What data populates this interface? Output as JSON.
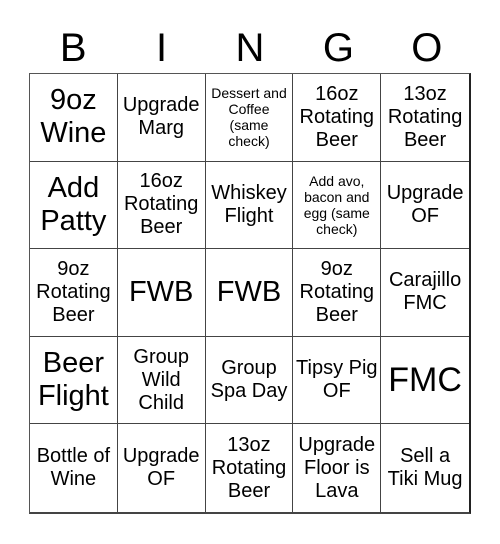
{
  "header": {
    "letters": [
      "B",
      "I",
      "N",
      "G",
      "O"
    ]
  },
  "cells": [
    {
      "text": "9oz Wine",
      "size": "l"
    },
    {
      "text": "Upgrade Marg",
      "size": "m"
    },
    {
      "text": "Dessert and Coffee (same check)",
      "size": "xs"
    },
    {
      "text": "16oz Rotating Beer",
      "size": "m"
    },
    {
      "text": "13oz Rotating Beer",
      "size": "m"
    },
    {
      "text": "Add Patty",
      "size": "l"
    },
    {
      "text": "16oz Rotating Beer",
      "size": "m"
    },
    {
      "text": "Whiskey Flight",
      "size": "m"
    },
    {
      "text": "Add avo, bacon and egg (same check)",
      "size": "xs"
    },
    {
      "text": "Upgrade OF",
      "size": "m"
    },
    {
      "text": "9oz Rotating Beer",
      "size": "m"
    },
    {
      "text": "FWB",
      "size": "l"
    },
    {
      "text": "FWB",
      "size": "l"
    },
    {
      "text": "9oz Rotating Beer",
      "size": "m"
    },
    {
      "text": "Carajillo FMC",
      "size": "m"
    },
    {
      "text": "Beer Flight",
      "size": "l"
    },
    {
      "text": "Group Wild Child",
      "size": "m"
    },
    {
      "text": "Group Spa Day",
      "size": "m"
    },
    {
      "text": "Tipsy Pig OF",
      "size": "m"
    },
    {
      "text": "FMC",
      "size": "xl"
    },
    {
      "text": "Bottle of Wine",
      "size": "m"
    },
    {
      "text": "Upgrade OF",
      "size": "m"
    },
    {
      "text": "13oz Rotating Beer",
      "size": "m"
    },
    {
      "text": "Upgrade Floor is Lava",
      "size": "m"
    },
    {
      "text": "Sell a Tiki Mug",
      "size": "m"
    }
  ]
}
